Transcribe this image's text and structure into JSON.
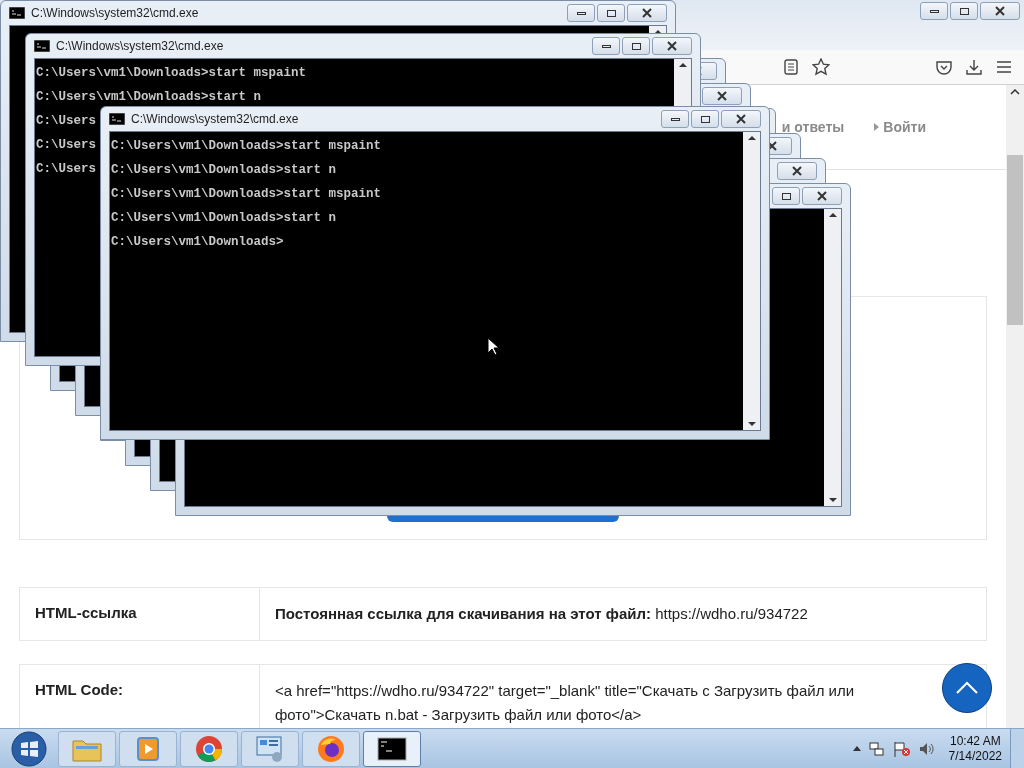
{
  "browser": {
    "nav": [
      {
        "label": "и ответы",
        "arrow": false
      },
      {
        "label": "Войти",
        "arrow": true
      }
    ],
    "table": {
      "rows": [
        {
          "label": "HTML-ссылка",
          "value": "**Постоянная ссылка для скачивания на этот файл:** https://wdho.ru/934722"
        },
        {
          "label": "HTML Code:",
          "value": "<a href=\"https://wdho.ru/934722\" target=\"_blank\" title=\"Скачать с Загрузить файл или фото\">Скачать n.bat - Загрузить файл или фото</a>"
        }
      ]
    }
  },
  "windows": [
    {
      "kind": "trail"
    },
    {
      "kind": "trail"
    },
    {
      "kind": "trail"
    },
    {
      "kind": "trail"
    },
    {
      "kind": "trail"
    },
    {
      "kind": "trail"
    },
    {
      "kind": "main",
      "title": "C:\\Windows\\system32\\cmd.exe"
    },
    {
      "kind": "middle",
      "title": "C:\\Windows\\system32\\cmd.exe",
      "lines": [
        "C:\\Users\\vm1\\Downloads>start mspaint",
        "C:\\Users\\vm1\\Downloads>start n",
        "C:\\Users",
        "C:\\Users",
        "C:\\Users"
      ]
    },
    {
      "kind": "front",
      "title": "C:\\Windows\\system32\\cmd.exe",
      "lines": [
        "C:\\Users\\vm1\\Downloads>start mspaint",
        "C:\\Users\\vm1\\Downloads>start n",
        "C:\\Users\\vm1\\Downloads>start mspaint",
        "C:\\Users\\vm1\\Downloads>start n",
        "C:\\Users\\vm1\\Downloads>"
      ]
    }
  ],
  "taskbar": {
    "apps": [
      {
        "kind": "folder",
        "selected": false
      },
      {
        "kind": "media",
        "selected": false
      },
      {
        "kind": "chrome",
        "selected": false
      },
      {
        "kind": "panel",
        "selected": false
      },
      {
        "kind": "firefox",
        "selected": false
      },
      {
        "kind": "console",
        "selected": true
      }
    ],
    "time": "10:42 AM",
    "date": "7/14/2022"
  }
}
